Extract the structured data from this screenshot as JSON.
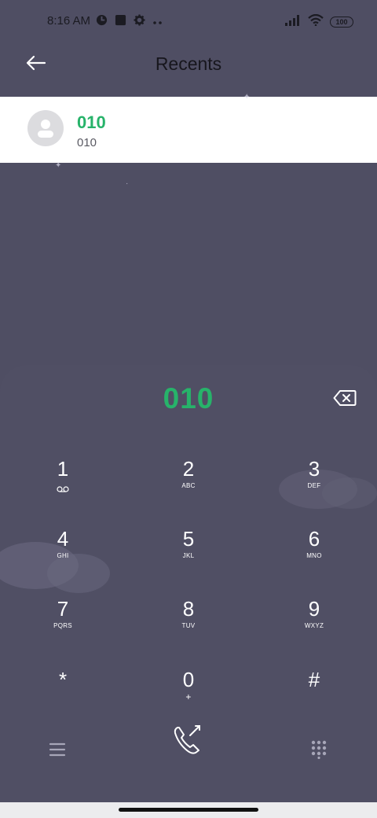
{
  "status_bar": {
    "time": "8:16 AM",
    "battery": "100",
    "left_icons": [
      "vpn-icon",
      "stop-icon",
      "settings-icon",
      "more-dots-icon"
    ],
    "right_icons": [
      "signal-icon",
      "wifi-icon",
      "battery-icon"
    ]
  },
  "header": {
    "title": "Recents",
    "back_icon": "back-arrow-icon"
  },
  "result": {
    "name": "010",
    "number": "010",
    "avatar_icon": "person-icon"
  },
  "dialer": {
    "input": "010",
    "backspace_icon": "backspace-icon",
    "keys": [
      {
        "digit": "1",
        "letters": "",
        "sub_icon": "voicemail-icon"
      },
      {
        "digit": "2",
        "letters": "ABC"
      },
      {
        "digit": "3",
        "letters": "DEF"
      },
      {
        "digit": "4",
        "letters": "GHI"
      },
      {
        "digit": "5",
        "letters": "JKL"
      },
      {
        "digit": "6",
        "letters": "MNO"
      },
      {
        "digit": "7",
        "letters": "PQRS"
      },
      {
        "digit": "8",
        "letters": "TUV"
      },
      {
        "digit": "9",
        "letters": "WXYZ"
      },
      {
        "digit": "*",
        "letters": ""
      },
      {
        "digit": "0",
        "letters": "+"
      },
      {
        "digit": "#",
        "letters": ""
      }
    ],
    "bottom": {
      "menu_icon": "menu-icon",
      "call_icon": "phone-icon",
      "keypad_icon": "dialpad-icon"
    }
  },
  "colors": {
    "accent_green": "#27b36a",
    "background": "#4f4e63",
    "row_background": "#ffffff"
  }
}
